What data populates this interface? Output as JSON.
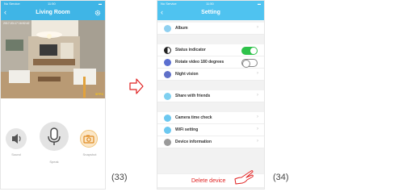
{
  "left_screen": {
    "status": {
      "carrier": "No Service",
      "time": "11:50"
    },
    "nav": {
      "title": "Living Room",
      "back_icon": "chevron-left-icon",
      "settings_icon": "gear-icon"
    },
    "video": {
      "timestamp": "2017-03-17 16:52:42",
      "fps": "5FPS"
    },
    "controls": {
      "sound_label": "Sound",
      "speak_label": "Speak",
      "snapshot_label": "Snapshot"
    },
    "figure_label": "(33)"
  },
  "right_screen": {
    "status": {
      "carrier": "No Service",
      "time": "11:50"
    },
    "nav": {
      "title": "Setting",
      "back_icon": "chevron-left-icon"
    },
    "items": {
      "album": "Album",
      "status_indicator": "Status indicator",
      "rotate": "Rotate video 180 degrees",
      "night_vision": "Night vision",
      "share": "Share with friends",
      "camera_time": "Camera time check",
      "wifi": "WiFi setting",
      "device_info": "Device information"
    },
    "toggles": {
      "status_indicator_on": true,
      "rotate_on": false
    },
    "delete_label": "Delete device",
    "figure_label": "(34)"
  },
  "colors": {
    "left_header": "#3fb5e6",
    "right_header": "#4fc3f0",
    "accent_orange": "#f0a040",
    "delete_red": "#e02020",
    "toggle_green": "#2ec24a"
  }
}
